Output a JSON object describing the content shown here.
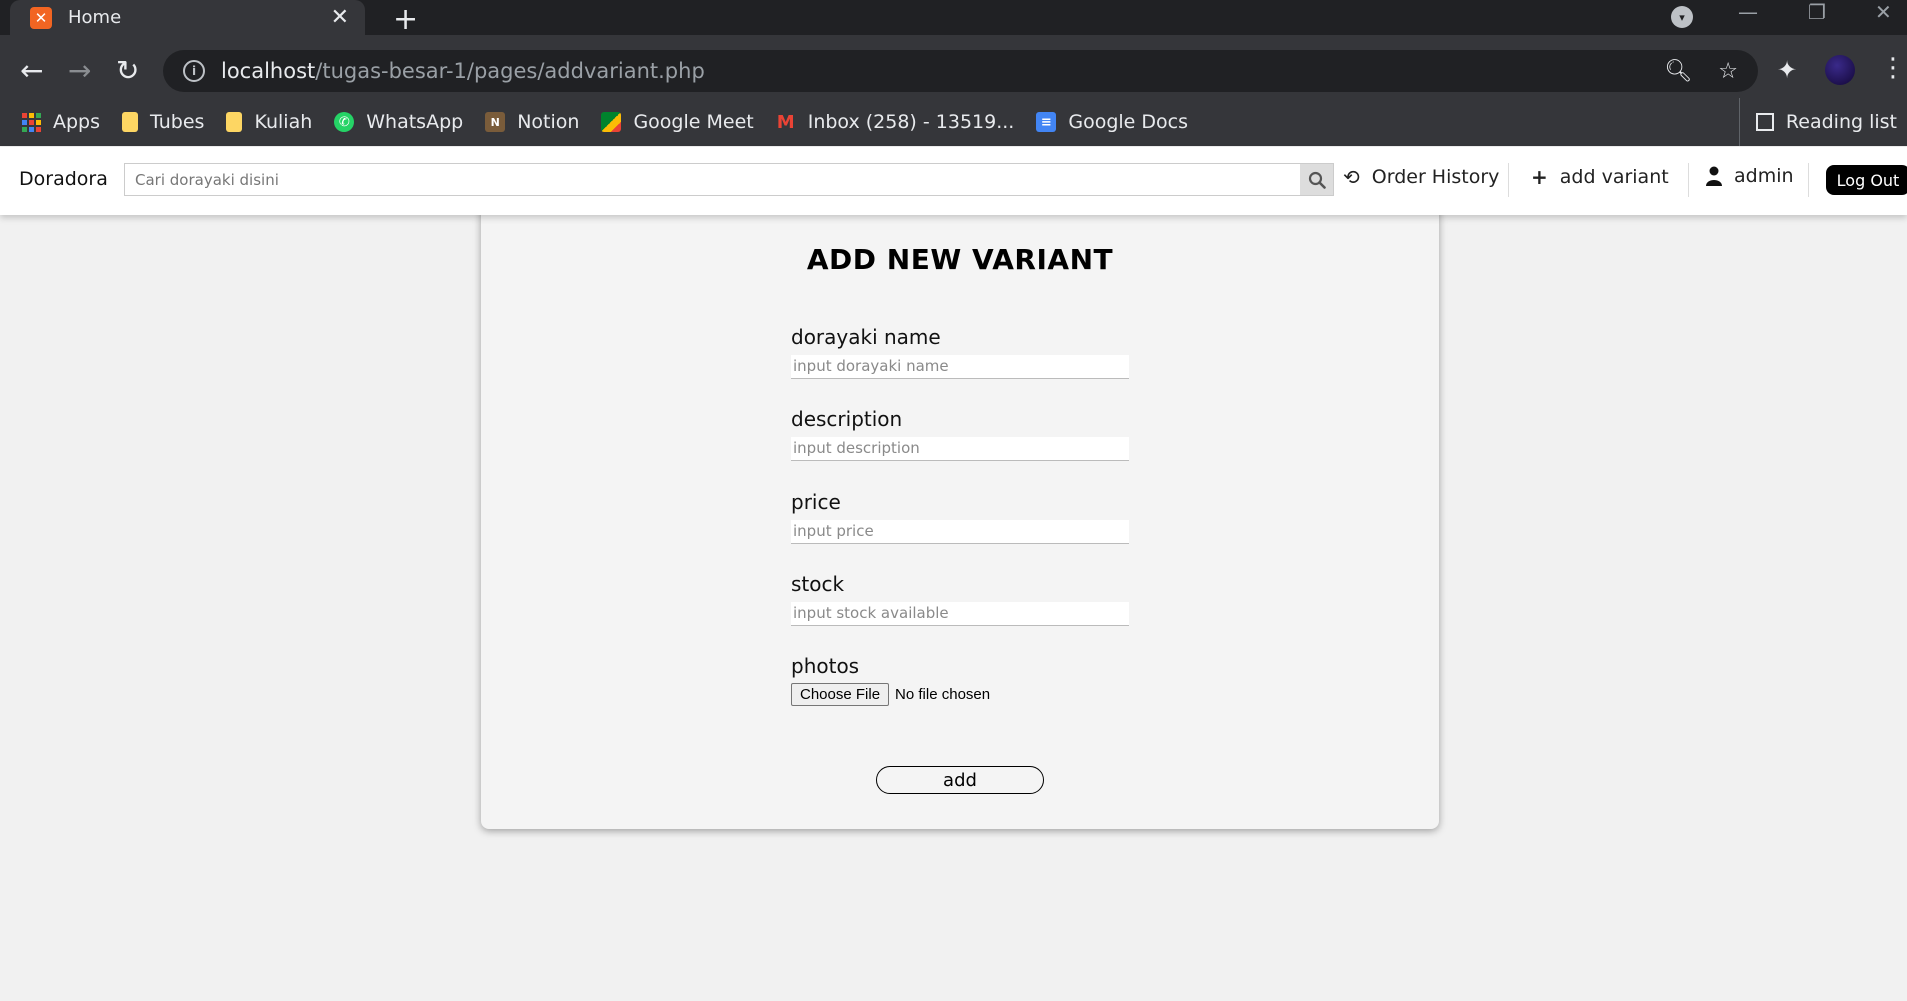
{
  "browser": {
    "tab_title": "Home",
    "url_host": "localhost",
    "url_path": "/tugas-besar-1/pages/addvariant.php",
    "bookmarks": [
      {
        "label": "Apps",
        "icon": "apps-grid-icon"
      },
      {
        "label": "Tubes",
        "icon": "folder-icon"
      },
      {
        "label": "Kuliah",
        "icon": "folder-icon"
      },
      {
        "label": "WhatsApp",
        "icon": "whatsapp-icon"
      },
      {
        "label": "Notion",
        "icon": "notion-icon"
      },
      {
        "label": "Google Meet",
        "icon": "google-meet-icon"
      },
      {
        "label": "Inbox (258) - 13519...",
        "icon": "gmail-icon"
      },
      {
        "label": "Google Docs",
        "icon": "google-docs-icon"
      }
    ],
    "reading_list": "Reading list"
  },
  "navbar": {
    "brand": "Doradora",
    "search_placeholder": "Cari dorayaki disini",
    "order_history": "Order History",
    "add_variant": "add variant",
    "user": "admin",
    "logout": "Log Out"
  },
  "form": {
    "title": "ADD NEW VARIANT",
    "fields": [
      {
        "label": "dorayaki name",
        "placeholder": "input dorayaki name"
      },
      {
        "label": "description",
        "placeholder": "input description"
      },
      {
        "label": "price",
        "placeholder": "input price"
      },
      {
        "label": "stock",
        "placeholder": "input stock available"
      }
    ],
    "photos_label": "photos",
    "file_button": "Choose File",
    "file_status": "No file chosen",
    "submit": "add"
  },
  "colors": {
    "chrome_dark": "#202124",
    "chrome_toolbar": "#35363a",
    "page_bg": "#f1f1f1",
    "logout_bg": "#000000",
    "favicon": "#f26522"
  }
}
